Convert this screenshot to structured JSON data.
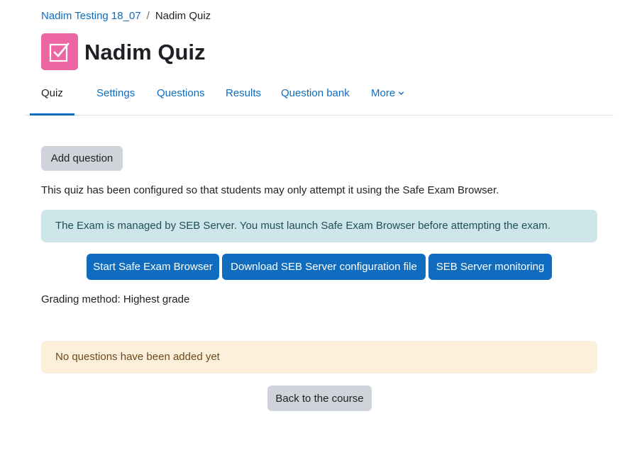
{
  "breadcrumb": {
    "course": "Nadim Testing 18_07",
    "separator": "/",
    "current": "Nadim Quiz"
  },
  "header": {
    "icon": "quiz-checkbox-icon",
    "icon_color": "#eb66a2",
    "title": "Nadim Quiz"
  },
  "nav": {
    "tabs": [
      {
        "label": "Quiz",
        "active": true
      },
      {
        "label": "Settings",
        "active": false
      },
      {
        "label": "Questions",
        "active": false
      },
      {
        "label": "Results",
        "active": false
      },
      {
        "label": "Question bank",
        "active": false
      },
      {
        "label": "More",
        "active": false
      }
    ],
    "more_icon": "chevron-down-icon"
  },
  "main": {
    "add_question_label": "Add question",
    "seb_notice": "This quiz has been configured so that students may only attempt it using the Safe Exam Browser.",
    "seb_alert": "The Exam is managed by SEB Server. You must launch Safe Exam Browser before attempting the exam.",
    "seb_buttons": {
      "start": "Start Safe Exam Browser",
      "download": "Download SEB Server configuration file",
      "monitoring": "SEB Server monitoring"
    },
    "grading_method": "Grading method: Highest grade",
    "no_questions_alert": "No questions have been added yet",
    "back_label": "Back to the course"
  },
  "colors": {
    "primary": "#0f6cbf",
    "secondary_button": "#ced4da",
    "info_alert_bg": "#cee6ea",
    "warning_alert_bg": "#fcefdc"
  }
}
